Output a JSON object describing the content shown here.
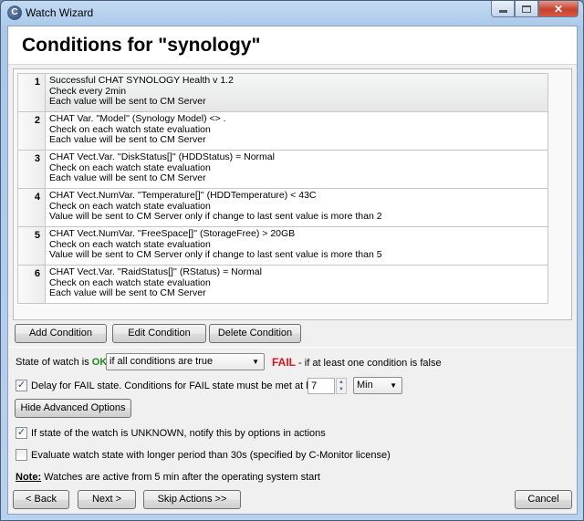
{
  "window": {
    "title": "Watch Wizard",
    "app_icon": "c-monitor-app-icon",
    "controls": {
      "minimize": "minimize-icon",
      "maximize": "maximize-icon",
      "close": "close-icon"
    }
  },
  "header": {
    "title": "Conditions for \"synology\""
  },
  "conditions": [
    {
      "num": "1",
      "selected": true,
      "lines": [
        "Successful CHAT SYNOLOGY Health v 1.2",
        "Check every 2min",
        "Each value will be sent to CM Server"
      ]
    },
    {
      "num": "2",
      "selected": false,
      "lines": [
        "CHAT Var. ''Model'' (Synology Model) <> .",
        "Check on each watch state evaluation",
        "Each value will be sent to CM Server"
      ]
    },
    {
      "num": "3",
      "selected": false,
      "lines": [
        "CHAT Vect.Var. ''DiskStatus[]'' (HDDStatus) = Normal",
        "Check on each watch state evaluation",
        "Each value will be sent to CM Server"
      ]
    },
    {
      "num": "4",
      "selected": false,
      "lines": [
        "CHAT Vect.NumVar. ''Temperature[]'' (HDDTemperature) < 43C",
        "Check on each watch state evaluation",
        "Value will be sent to CM Server only if change to last sent value is more than 2"
      ]
    },
    {
      "num": "5",
      "selected": false,
      "lines": [
        "CHAT Vect.NumVar. ''FreeSpace[]'' (StorageFree) > 20GB",
        "Check on each watch state evaluation",
        "Value will be sent to CM Server only if change to last sent value is more than 5"
      ]
    },
    {
      "num": "6",
      "selected": false,
      "lines": [
        "CHAT Vect.Var. ''RaidStatus[]'' (RStatus) = Normal",
        "Check on each watch state evaluation",
        "Each value will be sent to CM Server"
      ]
    }
  ],
  "list_buttons": {
    "add": "Add Condition",
    "edit": "Edit Condition",
    "delete": "Delete Condition"
  },
  "state": {
    "prefix": "State of watch is",
    "ok_label": "OK",
    "ok_color": "#1b8a1b",
    "mode_selected": "if all conditions are true",
    "fail_label": "FAIL",
    "fail_color": "#e0121b",
    "fail_suffix": " - if at least one condition is false"
  },
  "delay": {
    "checked": true,
    "label": "Delay for FAIL state. Conditions for FAIL state must be met at least",
    "value": "7",
    "unit_selected": "Min"
  },
  "advanced_button": "Hide Advanced Options",
  "unknown_option": {
    "checked": true,
    "label": "If state of the watch is UNKNOWN, notify this by options in actions"
  },
  "longer_period_option": {
    "checked": false,
    "label": "Evaluate watch state with longer period than 30s (specified by C-Monitor license)"
  },
  "note": {
    "label": "Note:",
    "text": " Watches are active from 5 min after the operating system start"
  },
  "footer_buttons": {
    "back": "< Back",
    "next": "Next >",
    "skip": "Skip Actions >>",
    "cancel": "Cancel"
  }
}
